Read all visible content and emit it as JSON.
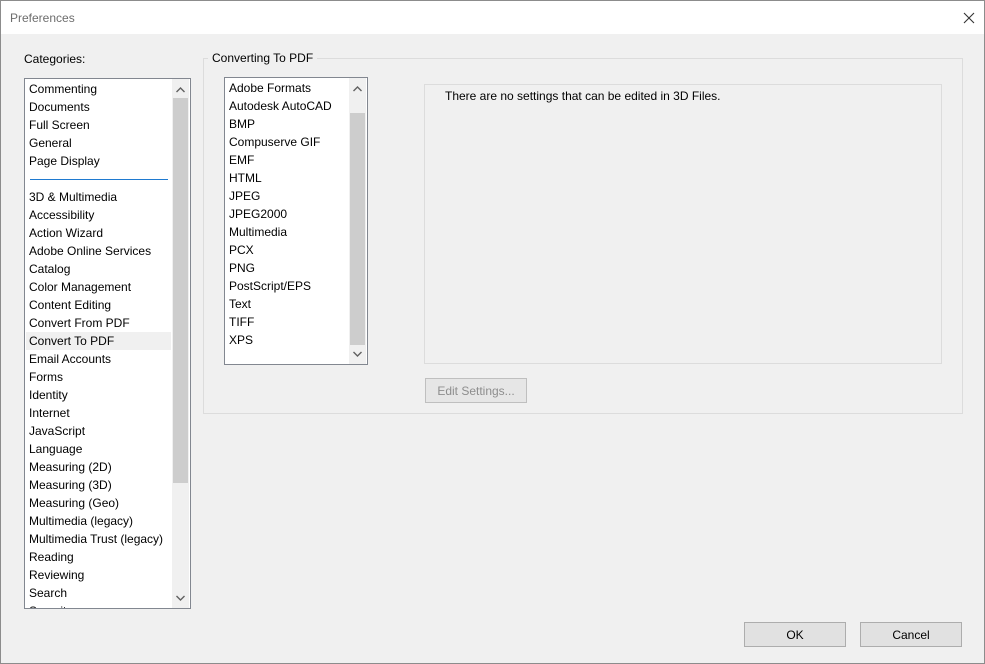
{
  "window": {
    "title": "Preferences"
  },
  "categories": {
    "label": "Categories:",
    "top_items": [
      "Commenting",
      "Documents",
      "Full Screen",
      "General",
      "Page Display"
    ],
    "items": [
      "3D & Multimedia",
      "Accessibility",
      "Action Wizard",
      "Adobe Online Services",
      "Catalog",
      "Color Management",
      "Content Editing",
      "Convert From PDF",
      "Convert To PDF",
      "Email Accounts",
      "Forms",
      "Identity",
      "Internet",
      "JavaScript",
      "Language",
      "Measuring (2D)",
      "Measuring (3D)",
      "Measuring (Geo)",
      "Multimedia (legacy)",
      "Multimedia Trust (legacy)",
      "Reading",
      "Reviewing",
      "Search",
      "Security"
    ],
    "selected": "Convert To PDF"
  },
  "converting": {
    "group_label": "Converting To PDF",
    "formats": [
      "Adobe Formats",
      "Autodesk AutoCAD",
      "BMP",
      "Compuserve GIF",
      "EMF",
      "HTML",
      "JPEG",
      "JPEG2000",
      "Multimedia",
      "PCX",
      "PNG",
      "PostScript/EPS",
      "Text",
      "TIFF",
      "XPS"
    ],
    "settings_message": "There are no settings that can be edited in 3D Files.",
    "edit_settings_label": "Edit Settings..."
  },
  "footer": {
    "ok_label": "OK",
    "cancel_label": "Cancel"
  }
}
